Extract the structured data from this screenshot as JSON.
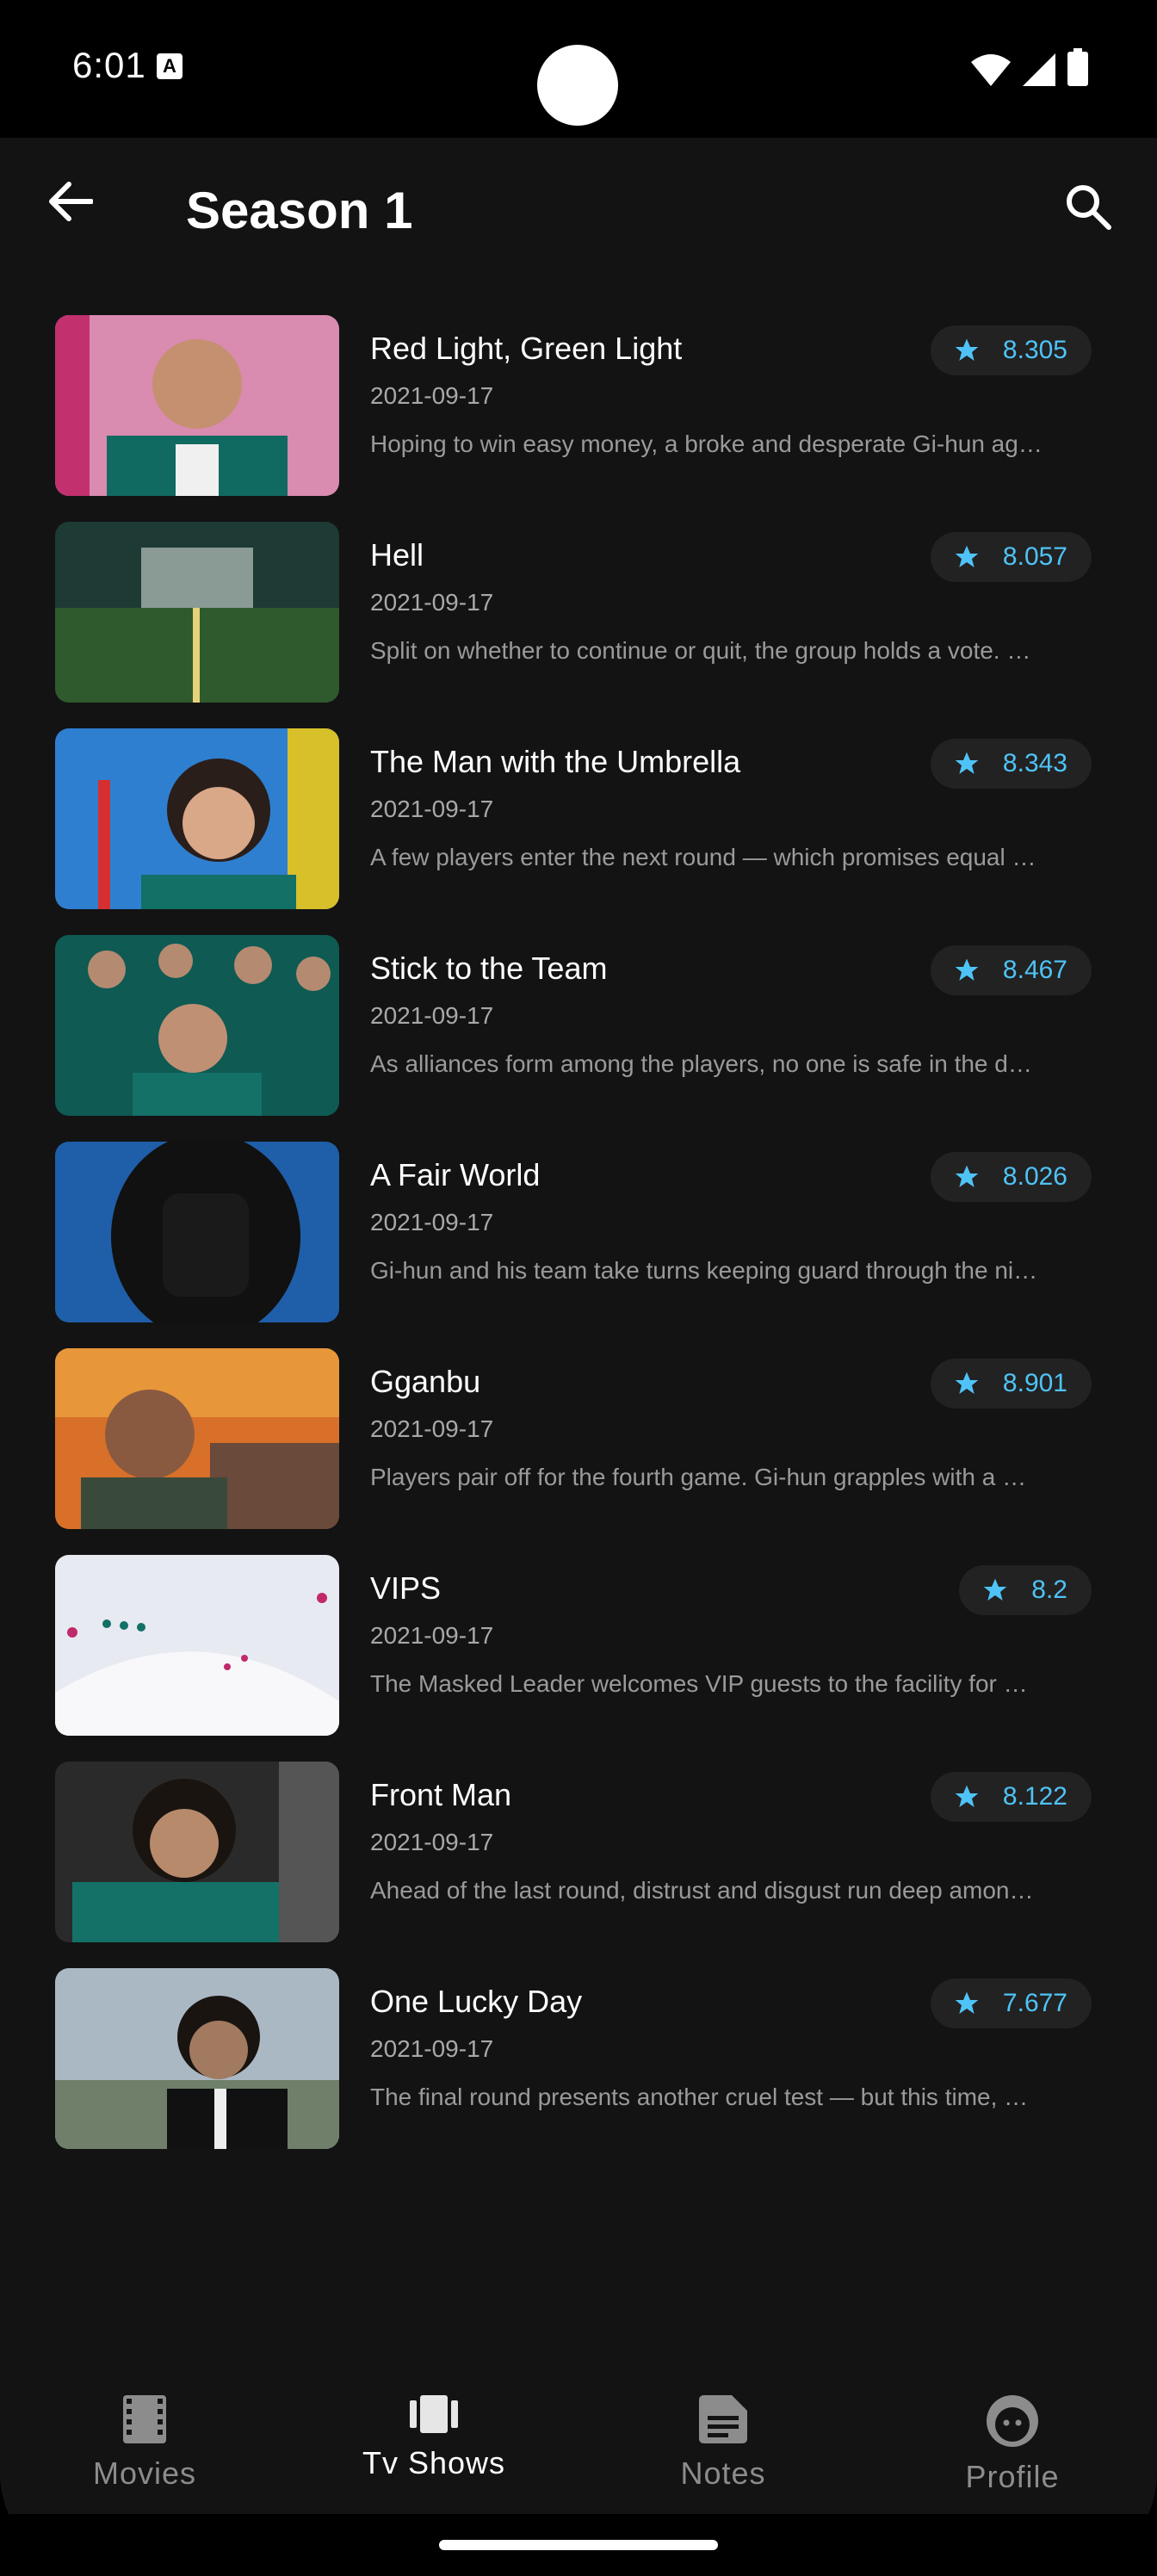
{
  "status_bar": {
    "time": "6:01",
    "badge": "A"
  },
  "header": {
    "title": "Season 1"
  },
  "colors": {
    "accent": "#4fc3f7",
    "background": "#131313",
    "chip": "#222222"
  },
  "episodes": [
    {
      "title": "Red Light, Green Light",
      "date": "2021-09-17",
      "overview": "Hoping to win easy money, a broke and desperate Gi-hun ag…",
      "rating": "8.305"
    },
    {
      "title": "Hell",
      "date": "2021-09-17",
      "overview": "Split on whether to continue or quit, the group holds a vote. …",
      "rating": "8.057"
    },
    {
      "title": "The Man with the Umbrella",
      "date": "2021-09-17",
      "overview": "A few players enter the next round — which promises equal …",
      "rating": "8.343"
    },
    {
      "title": "Stick to the Team",
      "date": "2021-09-17",
      "overview": "As alliances form among the players, no one is safe in the d…",
      "rating": "8.467"
    },
    {
      "title": "A Fair World",
      "date": "2021-09-17",
      "overview": "Gi-hun and his team take turns keeping guard through the ni…",
      "rating": "8.026"
    },
    {
      "title": "Gganbu",
      "date": "2021-09-17",
      "overview": "Players pair off for the fourth game. Gi-hun grapples with a …",
      "rating": "8.901"
    },
    {
      "title": "VIPS",
      "date": "2021-09-17",
      "overview": "The Masked Leader welcomes VIP guests to the facility for …",
      "rating": "8.2"
    },
    {
      "title": "Front Man",
      "date": "2021-09-17",
      "overview": "Ahead of the last round, distrust and disgust run deep amon…",
      "rating": "8.122"
    },
    {
      "title": "One Lucky Day",
      "date": "2021-09-17",
      "overview": "The final round presents another cruel test — but this time, …",
      "rating": "7.677"
    }
  ],
  "bottom_nav": {
    "items": [
      {
        "label": "Movies",
        "icon": "film-icon",
        "active": false
      },
      {
        "label": "Tv Shows",
        "icon": "tv-shows-icon",
        "active": true
      },
      {
        "label": "Notes",
        "icon": "notes-icon",
        "active": false
      },
      {
        "label": "Profile",
        "icon": "profile-icon",
        "active": false
      }
    ]
  }
}
